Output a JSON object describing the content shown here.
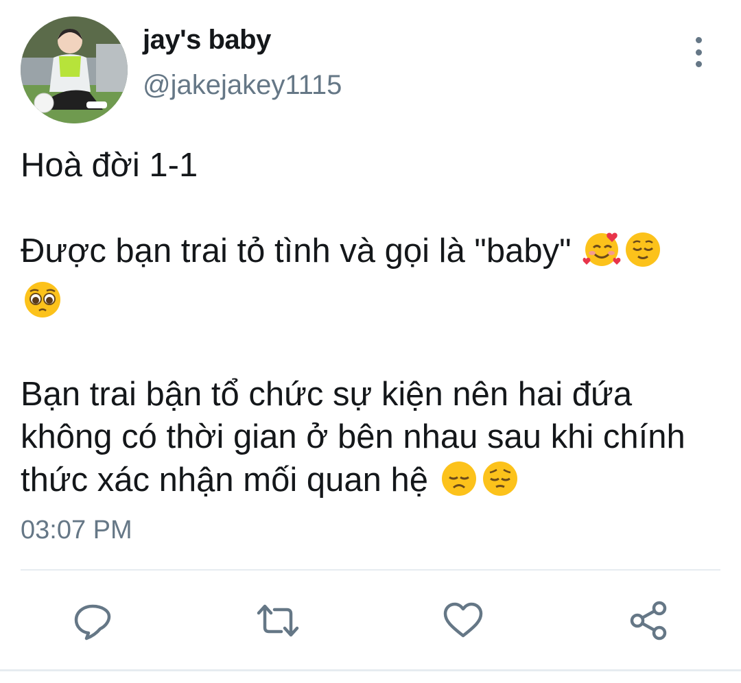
{
  "user": {
    "display_name": "jay's baby",
    "handle": "@jakejakey1115",
    "avatar_icon": "profile-photo"
  },
  "tweet": {
    "line1": "Hoà đời 1-1",
    "line2": "Được bạn trai tỏ tình và gọi là \"baby\"",
    "line2_emojis": [
      "smiling-face-with-hearts",
      "relieved-face",
      "pleading-face"
    ],
    "line3": "Bạn trai bận tổ chức sự kiện nên hai đứa không có thời gian ở bên nhau sau khi chính thức xác nhận mối quan hệ",
    "line3_emojis": [
      "disappointed-face",
      "pensive-face"
    ]
  },
  "timestamp": "03:07 PM",
  "actions": [
    "reply-icon",
    "retweet-icon",
    "like-icon",
    "share-icon"
  ],
  "colors": {
    "text": "#14171a",
    "secondary": "#657786",
    "divider": "#e6ecf0",
    "emoji_yellow": "#fcc21b"
  }
}
